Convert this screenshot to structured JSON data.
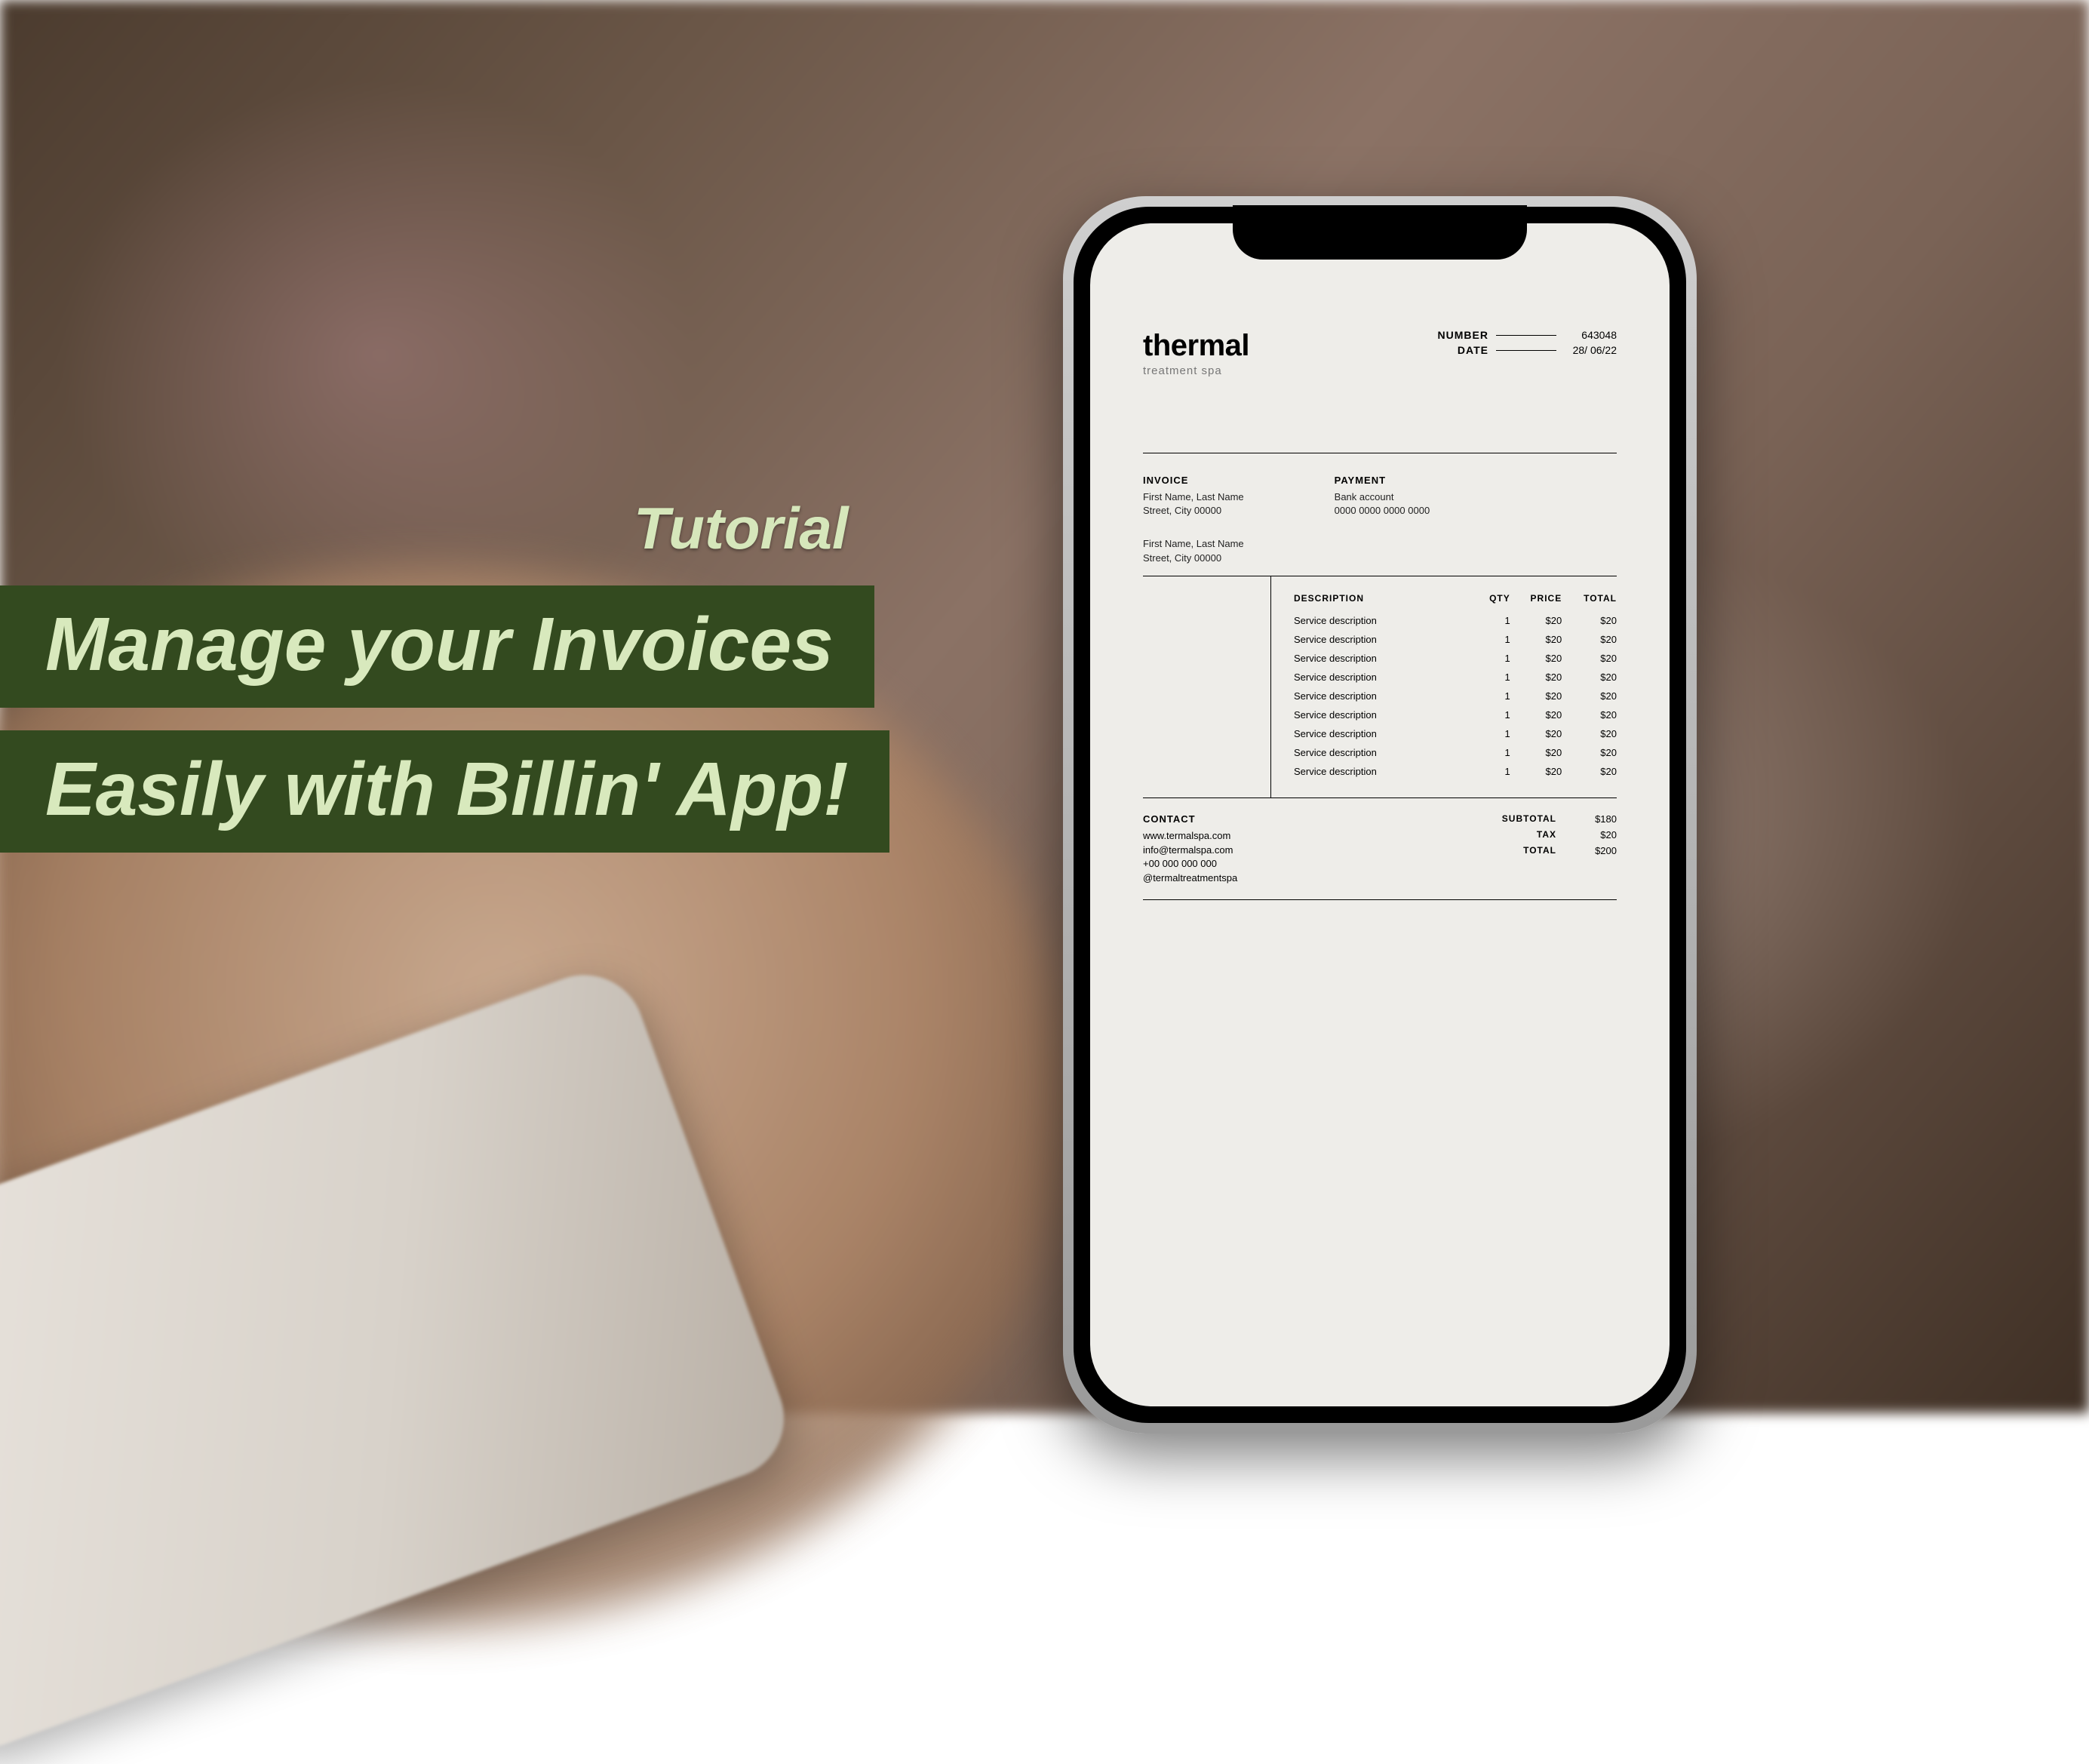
{
  "overlay": {
    "small": "Tutorial",
    "line1": "Manage your Invoices",
    "line2": "Easily with Billin' App!"
  },
  "invoice": {
    "brand": {
      "name": "thermal",
      "sub": "treatment spa"
    },
    "meta": {
      "number_label": "NUMBER",
      "number": "643048",
      "date_label": "DATE",
      "date": "28/ 06/22"
    },
    "billto": {
      "heading": "INVOICE",
      "name": "First Name, Last Name",
      "addr": "Street, City 00000"
    },
    "payment": {
      "heading": "PAYMENT",
      "acct": "Bank account",
      "num": "0000 0000 0000 0000"
    },
    "shipto": {
      "name": "First Name, Last Name",
      "addr": "Street, City 00000"
    },
    "columns": {
      "desc": "DESCRIPTION",
      "qty": "QTY",
      "price": "PRICE",
      "total": "TOTAL"
    },
    "items": [
      {
        "desc": "Service description",
        "qty": "1",
        "price": "$20",
        "total": "$20"
      },
      {
        "desc": "Service description",
        "qty": "1",
        "price": "$20",
        "total": "$20"
      },
      {
        "desc": "Service description",
        "qty": "1",
        "price": "$20",
        "total": "$20"
      },
      {
        "desc": "Service description",
        "qty": "1",
        "price": "$20",
        "total": "$20"
      },
      {
        "desc": "Service description",
        "qty": "1",
        "price": "$20",
        "total": "$20"
      },
      {
        "desc": "Service description",
        "qty": "1",
        "price": "$20",
        "total": "$20"
      },
      {
        "desc": "Service description",
        "qty": "1",
        "price": "$20",
        "total": "$20"
      },
      {
        "desc": "Service description",
        "qty": "1",
        "price": "$20",
        "total": "$20"
      },
      {
        "desc": "Service description",
        "qty": "1",
        "price": "$20",
        "total": "$20"
      }
    ],
    "contact": {
      "heading": "CONTACT",
      "web": "www.termalspa.com",
      "mail": "info@termalspa.com",
      "phone": "+00 000 000 000",
      "social": "@termaltreatmentspa"
    },
    "totals": {
      "subtotal_label": "SUBTOTAL",
      "subtotal": "$180",
      "tax_label": "TAX",
      "tax": "$20",
      "total_label": "TOTAL",
      "total": "$200"
    }
  }
}
